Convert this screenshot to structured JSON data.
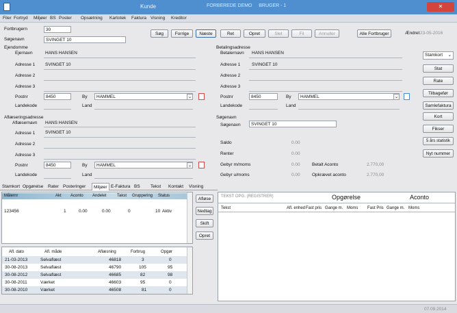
{
  "window": {
    "title": "Kunde",
    "title_extra": "FORBEREDE DEMO",
    "context": "BRUGER - 1",
    "close_label": "✕"
  },
  "menu": [
    "Filer",
    "Fortryd",
    "Miljøer",
    "BS",
    "Poster",
    "Opsætning",
    "Kartotek",
    "Faktura",
    "Visning",
    "Kreditor"
  ],
  "top": {
    "fortbruger_label": "Fortbrugern",
    "fortbruger_value": "30",
    "soegenavn_label": "Søgenavn",
    "soegenavn_value": "SVINGET 10",
    "buttons": [
      "Søg",
      "Forrige",
      "Næste",
      "Ret",
      "Opret",
      "Slet",
      "Fil",
      "Annuller"
    ],
    "alle_fortbruger": "Alle Fortbruger",
    "aendret_label": "Ændret",
    "aendret_value": "23-05-2016"
  },
  "ejendom": {
    "title": "Ejendomme",
    "ejernavn_label": "Ejernavn",
    "ejernavn": "HANS HANSEN",
    "adresse1_label": "Adresse 1",
    "adresse1": "SVINGET 10",
    "adresse2_label": "Adresse 2",
    "adresse3_label": "Adresse 3",
    "postnr_label": "Postnr",
    "postnr": "8450",
    "by_label": "By",
    "by": "HAMMEL",
    "landekode_label": "Landekode",
    "land_label": "Land"
  },
  "afl": {
    "title": "Aflæseringsadresse",
    "navn_label": "Aflæsernavn",
    "navn": "HANS HANSEN",
    "adresse1_label": "Adresse 1",
    "adresse1": "SVINGET 10",
    "adresse2_label": "Adresse 2",
    "adresse3_label": "Adresse 3",
    "postnr_label": "Postnr",
    "postnr": "8450",
    "by_label": "By",
    "by": "HAMMEL",
    "landekode_label": "Landekode",
    "land_label": "Land"
  },
  "betal": {
    "title": "Betalingsadresse",
    "navn_label": "Betalernavn",
    "navn": "HANS HANSEN",
    "adresse1_label": "Adresse 1",
    "adresse1": "SVINGET 10",
    "adresse2_label": "Adresse 2",
    "adresse3_label": "Adresse 3",
    "postnr_label": "Postnr",
    "postnr": "8450",
    "by_label": "By",
    "by": "HAMMEL",
    "landekode_label": "Landekode",
    "land_label": "Land"
  },
  "soeg": {
    "title": "Søgenavn",
    "label": "Søgenavn",
    "value": "SVINGET 10",
    "saldo_label": "Saldo",
    "saldo": "0.00",
    "renter_label": "Renter",
    "renter": "0.00",
    "gebyr_moms_label": "Gebyr m/moms",
    "gebyr_moms": "0.00",
    "gebyr_umoms_label": "Gebyr u/moms",
    "gebyr_umoms": "0.00",
    "betalt_label": "Betalt Aconto",
    "betalt": "2.770,00",
    "opkraevet_label": "Opkrævet aconto",
    "opkraevet": "2.770,00"
  },
  "side": {
    "dropdown": "Stamkort",
    "buttons": [
      "Stat",
      "Rate",
      "Tilbagefør",
      "Samlefaktura",
      "Kort",
      "Fikser",
      "5 års statistik",
      "Nyt nummer"
    ]
  },
  "tabs": [
    "Stamkort",
    "Opgørelse",
    "Rater",
    "Posteringer",
    "Miljøer",
    "E-Faktura",
    "BS",
    "Tekst",
    "Kontakt",
    "Visning"
  ],
  "maaler": {
    "headers": [
      "Målernr",
      "Akt",
      "Aconto",
      "Andelet",
      "Takst",
      "Gruppering",
      "Status"
    ],
    "rows": [
      [
        "123456",
        "1",
        "0.00",
        "0.00",
        "0",
        "10",
        "Aktiv"
      ]
    ]
  },
  "maaler_buttons": [
    "Afløse",
    "Nedtag",
    "Skift",
    "Opret"
  ],
  "readings": {
    "headers": [
      "Afl. dato",
      "Afl. måde",
      "Aflæsning",
      "Forbrug",
      "Opgør"
    ],
    "rows": [
      [
        "21-03-2013",
        "Selvaflæst",
        "46818",
        "3",
        "0"
      ],
      [
        "30-08-2013",
        "Selvaflæst",
        "46790",
        "105",
        "95"
      ],
      [
        "30-08-2012",
        "Selvaflæst",
        "46685",
        "82",
        "98"
      ],
      [
        "30-08-2011",
        "Værket",
        "46603",
        "95",
        "0"
      ],
      [
        "30-08-2010",
        "Værket",
        "46508",
        "81",
        "0"
      ]
    ]
  },
  "opg": {
    "header_left": "TEKST OPG. (REGISTRER)",
    "header_center": "Opgørelse",
    "header_right": "Aconto",
    "cols": [
      "Tekst",
      "Afl. enhed",
      "Fast pris",
      "Gange m.",
      "Moms",
      "Fast Pris",
      "Gange m.",
      "Moms"
    ]
  },
  "status": {
    "right": "07.09.2014"
  }
}
